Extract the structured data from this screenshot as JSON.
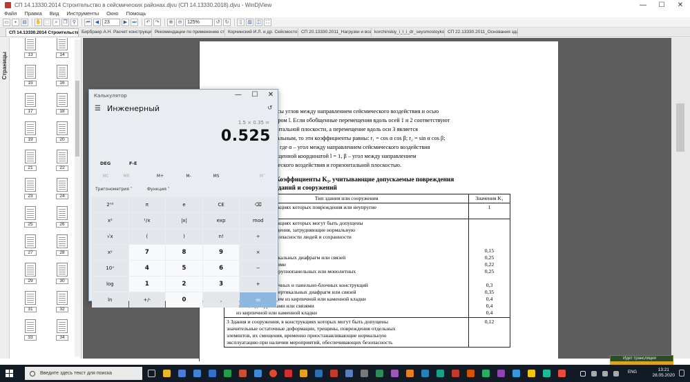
{
  "window": {
    "title": "СП 14.13330.2014 Строительство в сейсмических районах.djvu (СП 14.13330.2018).djvu - WinDjView",
    "minimize": "—",
    "maximize": "☐",
    "close": "✕"
  },
  "menu": [
    "Файл",
    "Правка",
    "Вид",
    "Инструменты",
    "Окно",
    "Помощь"
  ],
  "toolbar": {
    "page_number": "23",
    "zoom": "125%"
  },
  "tabs": [
    "СП 14.13330.2014 Строительство в ...",
    "Бирбраер А.Н. Расчет конструкций на с...",
    "Рекомендации по применению стальных...",
    "Корчинский И.Л. и др. Сейсмостойкое с...",
    "СП 20.13330.2011_Нагрузки и воздейст...",
    "korchinskiy_i_l_i_dr_seysmostoykoe_strait...",
    "СП 22.13330.2011_Основания зданий и..."
  ],
  "sidepanel": {
    "label": "Страницы",
    "page_numbers": [
      "13",
      "14",
      "15",
      "16",
      "17",
      "18",
      "19",
      "20",
      "21",
      "22",
      "23",
      "24",
      "25",
      "26",
      "27",
      "28",
      "29",
      "30",
      "31",
      "32",
      "33",
      "34"
    ]
  },
  "document": {
    "cut_heading": "14",
    "paragraph": [
      "синусы углов между направлением сейсмического воздействия и осью",
      "номером l. Если обобщенные перемещения вдоль осей 1 и 2 соответствуют",
      "ризонтальной плоскости, а перемещение вдоль оси 3 является",
      "ртикальным, то эти коэффициенты равны: r₁ = cos α cos β; r₂ = sin α cos β;",
      "sin β, где α – угол между направлением сейсмического воздействия",
      "обобщенной координатой l = 1, β – угол между направлением",
      "смического воздействия и горизонтальной плоскостью."
    ],
    "table_heading_1": "3 – Коэффициенты K₁, учитывающие допускаемые повреждения",
    "table_heading_2": "зданий и сооружений",
    "table": {
      "col_type": "Тип здания или сооружения",
      "col_value": "Значения K₁",
      "rows": [
        {
          "lines": [
            "сооружения, в конструкциях которых повреждения или неупругие",
            "е допускаются"
          ],
          "values": [
            "1"
          ]
        },
        {
          "lines": [
            "сооружения, в конструкциях которых могут быть допущены",
            "деформации и повреждения, затрудняющие нормальную",
            "я, при обеспечении безопасности людей и сохранности",
            "я, возводимые:",
            "х конструкций",
            "ым каркасом без вертикальных диафрагм или связей",
            "диафрагмами или связями",
            "и из железобетонных крупнопанельных или монолитных",
            "",
            "бетонных объемно-блочных и панельно-блочных конструкций",
            "тонным каркасом без вертикальных диафрагм или связей",
            "то же, с заполнением из кирпичной или каменной кладки",
            "то же, с диафрагмами или связями",
            "из кирпичной или каменной кладки"
          ],
          "values": [
            "",
            "",
            "",
            "",
            "0,15",
            "0,25",
            "0,22",
            "0,25",
            "",
            "0,3",
            "0,35",
            "0,4",
            "0,4",
            "0,4"
          ]
        },
        {
          "lines": [
            "3 Здания и сооружения, в конструкциях которых могут быть допущены",
            "значительные остаточные деформации, трещины, повреждения отдельных",
            "элементов, их смещения, временно приостанавливающие нормальную",
            "эксплуатацию при наличии мероприятий, обеспечивающих безопасность"
          ],
          "values": [
            "0,12",
            "",
            "",
            ""
          ]
        }
      ]
    }
  },
  "calculator": {
    "title": "Калькулятор",
    "minimize": "—",
    "maximize": "☐",
    "close": "✕",
    "menu_icon": "☰",
    "mode": "Инженерный",
    "history_icon": "↺",
    "expression": "1.5 × 0.35 =",
    "display": "0.525",
    "angle": "DEG",
    "fe": "F-E",
    "memory": [
      "MC",
      "MR",
      "M+",
      "M-",
      "MS",
      "M˅"
    ],
    "functions": [
      "Тригонометрия ˅",
      "Функция ˅"
    ],
    "keys": [
      "2ⁿᵈ",
      "π",
      "e",
      "CE",
      "⌫",
      "x²",
      "¹/x",
      "|x|",
      "exp",
      "mod",
      "√x",
      "(",
      ")",
      "n!",
      "÷",
      "xʸ",
      "7",
      "8",
      "9",
      "×",
      "10ˣ",
      "4",
      "5",
      "6",
      "−",
      "log",
      "1",
      "2",
      "3",
      "+",
      "ln",
      "+/-",
      "0",
      ",",
      "="
    ]
  },
  "taskbar": {
    "search_placeholder": "Введите здесь текст для поиска",
    "time": "13:21",
    "date": "28.05.2020",
    "language": "ENG",
    "notification": "Идет трансляция"
  },
  "colors": {
    "viewport": "#5d5d5d",
    "taskbar": "#111a25",
    "calc_equals": "#8cb8e2"
  }
}
